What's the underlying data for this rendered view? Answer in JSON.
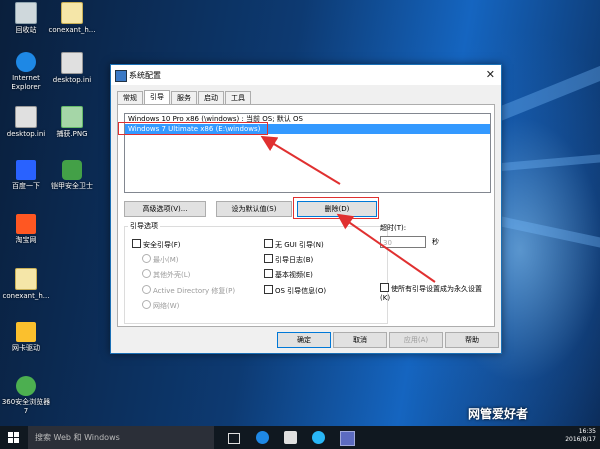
{
  "desktop": {
    "icons": [
      {
        "label": "回收站"
      },
      {
        "label": "conexant_h..."
      },
      {
        "label": "Internet Explorer"
      },
      {
        "label": "desktop.ini"
      },
      {
        "label": "desktop.ini"
      },
      {
        "label": "捕获.PNG"
      },
      {
        "label": "百度一下"
      },
      {
        "label": "铠甲安全卫士"
      },
      {
        "label": "淘宝网"
      },
      {
        "label": "conexant_h..."
      },
      {
        "label": "网卡驱动"
      },
      {
        "label": "360安全浏览器7"
      }
    ]
  },
  "dialog": {
    "title": "系统配置",
    "tabs": [
      "常规",
      "引导",
      "服务",
      "启动",
      "工具"
    ],
    "active_tab": "引导",
    "os_entries": [
      {
        "text": "Windows 10 Pro x86 (\\windows) : 当前 OS; 默认 OS",
        "selected": false
      },
      {
        "text": "Windows 7 Ultimate x86 (E:\\windows)",
        "selected": true
      }
    ],
    "buttons": {
      "advanced": "高级选项(V)...",
      "set_default": "设为默认值(S)",
      "delete": "删除(D)"
    },
    "boot_options": {
      "group_label": "引导选项",
      "safe_boot": "安全引导(F)",
      "minimal": "最小(M)",
      "alternate_shell": "其他外壳(L)",
      "active_directory": "Active Directory 修复(P)",
      "network": "网络(W)",
      "no_gui": "无 GUI 引导(N)",
      "boot_log": "引导日志(B)",
      "base_video": "基本视频(E)",
      "os_boot_info": "OS 引导信息(O)"
    },
    "timeout": {
      "label": "超时(T):",
      "value": "30",
      "unit": "秒"
    },
    "make_permanent": "使所有引导设置成为永久设置(K)",
    "footer": {
      "ok": "确定",
      "cancel": "取消",
      "apply": "应用(A)",
      "help": "帮助"
    }
  },
  "taskbar": {
    "search_placeholder": "搜索 Web 和 Windows",
    "time": "16:35",
    "date": "2016/8/17"
  },
  "watermark": "网管爱好者"
}
